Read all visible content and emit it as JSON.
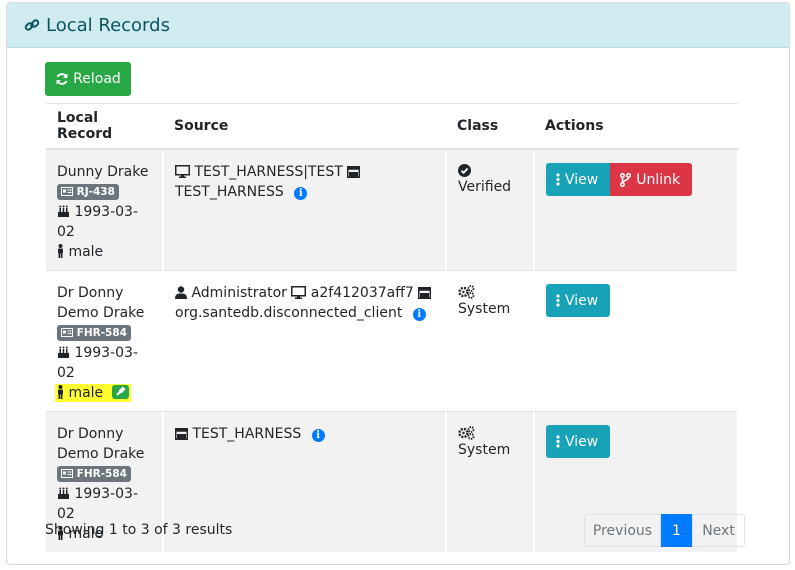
{
  "panel": {
    "title": "Local Records"
  },
  "toolbar": {
    "reload_label": "Reload"
  },
  "table": {
    "headers": [
      "Local Record",
      "Source",
      "Class",
      "Actions"
    ],
    "rows": [
      {
        "name": "Dunny Drake",
        "identifier": "RJ-438",
        "dob": "1993-03-02",
        "gender": "male",
        "source_device": "TEST_HARNESS|TEST",
        "source_app": "TEST_HARNESS",
        "class": "Verified",
        "view_label": "View",
        "unlink_label": "Unlink"
      },
      {
        "name": "Dr Donny Demo Drake",
        "identifier": "FHR-584",
        "dob": "1993-03-02",
        "gender": "male",
        "source_user": "Administrator",
        "source_device": "a2f412037aff7",
        "source_app": "org.santedb.disconnected_client",
        "class": "System",
        "view_label": "View"
      },
      {
        "name": "Dr Donny Demo Drake",
        "identifier": "FHR-584",
        "dob": "1993-03-02",
        "gender": "male",
        "source_app": "TEST_HARNESS",
        "class": "System",
        "view_label": "View"
      }
    ]
  },
  "footer": {
    "summary": "Showing 1 to 3 of 3 results",
    "prev_label": "Previous",
    "current_page": "1",
    "next_label": "Next"
  },
  "colors": {
    "header_bg": "#d1ecf1",
    "header_text": "#0c5460",
    "success": "#28a745",
    "info": "#17a2b8",
    "danger": "#dc3545",
    "primary": "#007bff",
    "highlight": "#ffff30"
  }
}
